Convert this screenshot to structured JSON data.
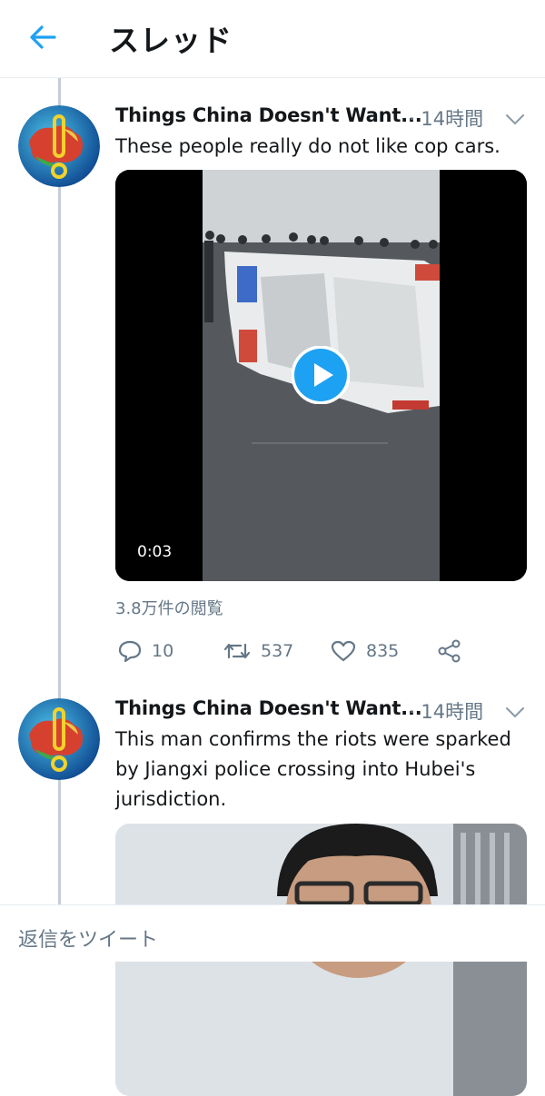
{
  "header": {
    "title": "スレッド",
    "back_icon": "arrow-left-icon"
  },
  "colors": {
    "accent": "#1da1f2",
    "muted": "#657786",
    "divider": "#e6ecf0",
    "thread_line": "#c4ced6"
  },
  "tweets": [
    {
      "author": "Things China Doesn't Want...",
      "time": "· 14時間",
      "text": "These people really do not like cop cars.",
      "media": {
        "type": "video",
        "duration": "0:03"
      },
      "views": "3.8万件の閲覧",
      "actions": {
        "replies": "10",
        "retweets": "537",
        "likes": "835"
      }
    },
    {
      "author": "Things China Doesn't Want...",
      "time": "· 14時間",
      "text": "This man confirms the riots were sparked by Jiangxi police crossing into Hubei's jurisdiction.",
      "media": {
        "type": "video"
      }
    }
  ],
  "reply_bar": {
    "placeholder": "返信をツイート"
  }
}
